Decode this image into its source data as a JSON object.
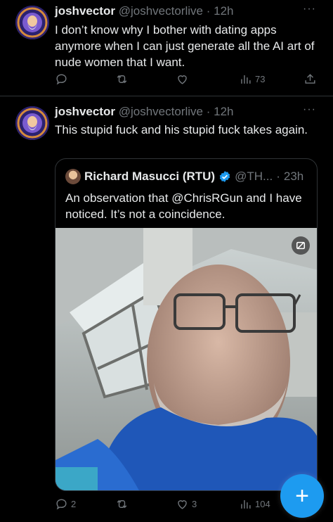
{
  "tweets": [
    {
      "name": "joshvector",
      "handle": "@joshvectorlive",
      "sep": "·",
      "time": "12h",
      "more": "···",
      "text": "I don’t know why I bother with dating apps anymore when I can just generate all the AI art of nude women that I want.",
      "actions": {
        "replies": "",
        "retweets": "",
        "likes": "",
        "views": "73"
      },
      "icons": [
        "reply-icon",
        "retweet-icon",
        "like-icon",
        "views-icon",
        "share-icon"
      ]
    },
    {
      "name": "joshvector",
      "handle": "@joshvectorlive",
      "sep": "·",
      "time": "12h",
      "more": "···",
      "text": "This stupid fuck and his stupid fuck takes again.",
      "quote": {
        "name": "Richard Masucci (RTU)",
        "handle": "@TH...",
        "sep": "·",
        "time": "23h",
        "text": "An observation that @ChrisRGun and I have noticed. It’s not a coincidence."
      },
      "actions": {
        "replies": "2",
        "retweets": "",
        "likes": "3",
        "views": "104"
      }
    }
  ],
  "fab": {
    "label": "+"
  },
  "colors": {
    "accent": "#1d9bf0",
    "muted": "#71767b",
    "text": "#e7e9ea",
    "background": "#000000"
  }
}
